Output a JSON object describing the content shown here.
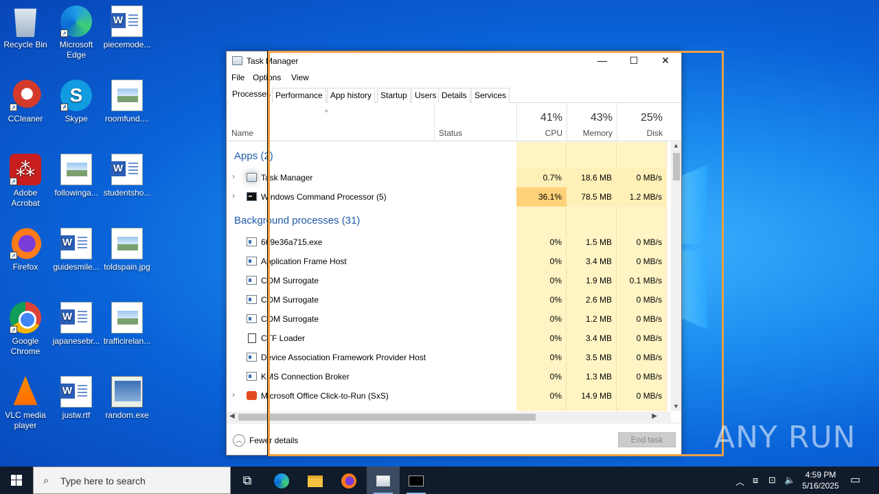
{
  "desktop_icons": [
    {
      "label": "Recycle Bin"
    },
    {
      "label": "Microsoft Edge"
    },
    {
      "label": "piecemode..."
    },
    {
      "label": "CCleaner"
    },
    {
      "label": "Skype"
    },
    {
      "label": "roomfund...."
    },
    {
      "label": "Adobe Acrobat"
    },
    {
      "label": "followinga..."
    },
    {
      "label": "studentsho..."
    },
    {
      "label": "Firefox"
    },
    {
      "label": "guidesmile..."
    },
    {
      "label": "toldspain.jpg"
    },
    {
      "label": "Google Chrome"
    },
    {
      "label": "japanesebr..."
    },
    {
      "label": "trafficirelan..."
    },
    {
      "label": "VLC media player"
    },
    {
      "label": "justw.rtf"
    },
    {
      "label": "random.exe"
    }
  ],
  "window": {
    "title": "Task Manager",
    "minimize": "—",
    "maximize": "☐",
    "close": "✕"
  },
  "menu": {
    "file": "File",
    "options": "Options",
    "view": "View"
  },
  "tabs": [
    "Processes",
    "Performance",
    "App history",
    "Startup",
    "Users",
    "Details",
    "Services"
  ],
  "columns": {
    "name": "Name",
    "status": "Status",
    "cpu": {
      "pct": "41%",
      "label": "CPU"
    },
    "memory": {
      "pct": "43%",
      "label": "Memory"
    },
    "disk": {
      "pct": "25%",
      "label": "Disk"
    }
  },
  "groups": {
    "apps": "Apps (2)",
    "background": "Background processes (31)"
  },
  "processes": [
    {
      "name": "Task Manager",
      "cpu": "0.7%",
      "memory": "18.6 MB",
      "disk": "0 MB/s"
    },
    {
      "name": "Windows Command Processor (5)",
      "cpu": "36.1%",
      "memory": "78.5 MB",
      "disk": "1.2 MB/s"
    },
    {
      "name": "669e36a715.exe",
      "cpu": "0%",
      "memory": "1.5 MB",
      "disk": "0 MB/s"
    },
    {
      "name": "Application Frame Host",
      "cpu": "0%",
      "memory": "3.4 MB",
      "disk": "0 MB/s"
    },
    {
      "name": "COM Surrogate",
      "cpu": "0%",
      "memory": "1.9 MB",
      "disk": "0.1 MB/s"
    },
    {
      "name": "COM Surrogate",
      "cpu": "0%",
      "memory": "2.6 MB",
      "disk": "0 MB/s"
    },
    {
      "name": "COM Surrogate",
      "cpu": "0%",
      "memory": "1.2 MB",
      "disk": "0 MB/s"
    },
    {
      "name": "CTF Loader",
      "cpu": "0%",
      "memory": "3.4 MB",
      "disk": "0 MB/s"
    },
    {
      "name": "Device Association Framework Provider Host",
      "cpu": "0%",
      "memory": "3.5 MB",
      "disk": "0 MB/s"
    },
    {
      "name": "KMS Connection Broker",
      "cpu": "0%",
      "memory": "1.3 MB",
      "disk": "0 MB/s"
    },
    {
      "name": "Microsoft Office Click-to-Run (SxS)",
      "cpu": "0%",
      "memory": "14.9 MB",
      "disk": "0 MB/s"
    }
  ],
  "footer": {
    "fewer_details": "Fewer details",
    "end_task": "End task"
  },
  "taskbar": {
    "search_placeholder": "Type here to search",
    "time": "4:59 PM",
    "date": "5/16/2025"
  },
  "watermark": "ANY RUN",
  "colors": {
    "cpu_high": "#ffd27a",
    "cpu_low": "#fff4c4",
    "group_text": "#1e5aa8",
    "highlight_box": "#f0a040"
  }
}
